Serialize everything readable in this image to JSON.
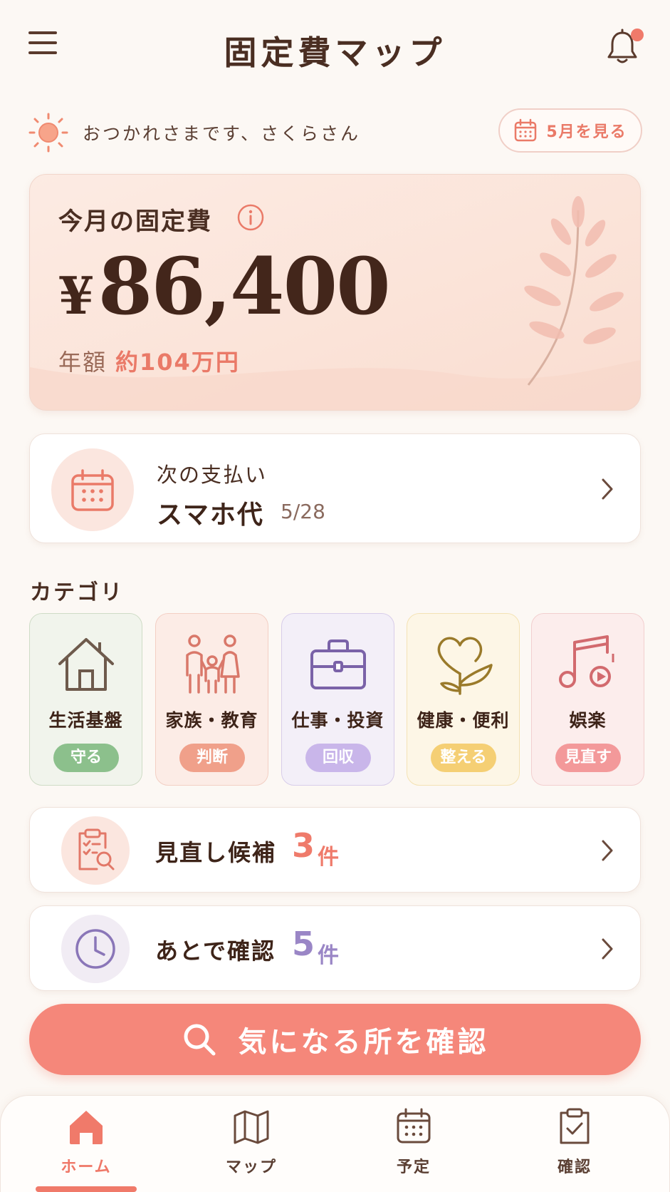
{
  "header": {
    "title": "固定費マップ"
  },
  "greeting": {
    "text": "おつかれさまです、さくらさん",
    "month_button": "5月を見る"
  },
  "summary": {
    "title": "今月の固定費",
    "currency": "¥",
    "amount": "86,400",
    "annual_label": "年額",
    "annual_value": "約104万円"
  },
  "next_payment": {
    "label": "次の支払い",
    "item": "スマホ代",
    "date": "5/28"
  },
  "categories": {
    "heading": "カテゴリ",
    "items": [
      {
        "name": "生活基盤",
        "tag": "守る",
        "icon": "house-icon",
        "bg": "#f1f4ec",
        "border": "#cfdcc6",
        "tag_color": "#8cc08c"
      },
      {
        "name": "家族・教育",
        "tag": "判断",
        "icon": "family-icon",
        "bg": "#fcece6",
        "border": "#f3cfc4",
        "tag_color": "#f0a08a"
      },
      {
        "name": "仕事・投資",
        "tag": "回収",
        "icon": "briefcase-icon",
        "bg": "#f3eff8",
        "border": "#d8cdea",
        "tag_color": "#c9b6ea"
      },
      {
        "name": "健康・便利",
        "tag": "整える",
        "icon": "heart-plant-icon",
        "bg": "#fdf6e6",
        "border": "#f4e2b4",
        "tag_color": "#f5cf74"
      },
      {
        "name": "娯楽",
        "tag": "見直す",
        "icon": "music-icon",
        "bg": "#fcedec",
        "border": "#f2cfcf",
        "tag_color": "#f3999a"
      }
    ]
  },
  "review": {
    "label": "見直し候補",
    "count": "3",
    "unit": "件",
    "accent": "#ef7b6b"
  },
  "later": {
    "label": "あとで確認",
    "count": "5",
    "unit": "件",
    "accent": "#9a86c6"
  },
  "cta": {
    "label": "気になる所を確認",
    "icon": "search-icon"
  },
  "bottom_nav": [
    {
      "label": "ホーム",
      "icon": "home-icon",
      "active": true
    },
    {
      "label": "マップ",
      "icon": "map-icon",
      "active": false
    },
    {
      "label": "予定",
      "icon": "calendar-icon",
      "active": false
    },
    {
      "label": "確認",
      "icon": "clipboard-check-icon",
      "active": false
    }
  ],
  "colors": {
    "accent": "#f5877a",
    "background": "#fcf8f4",
    "text": "#4a2e22"
  }
}
